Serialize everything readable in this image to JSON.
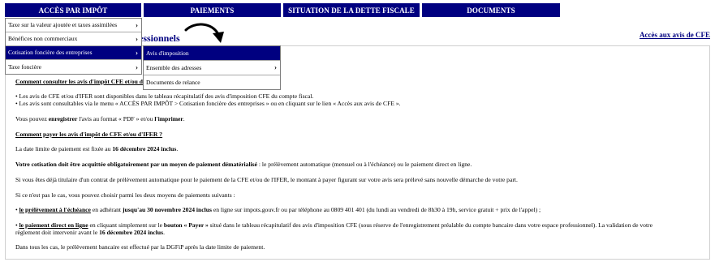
{
  "nav": {
    "tabs": [
      "ACCÈS PAR IMPÔT",
      "PAIEMENTS",
      "SITUATION DE LA DETTE FISCALE",
      "DOCUMENTS"
    ]
  },
  "menu": {
    "items": [
      "Taxe sur la valeur ajoutée et taxes assimilées",
      "Bénéfices non commerciaux",
      "Cotisation foncière des entreprises",
      "Taxe foncière"
    ],
    "chevron": "›"
  },
  "submenu": {
    "items": [
      "Avis d'imposition",
      "Ensemble des adresses",
      "Documents de relance"
    ]
  },
  "header": {
    "title_fragment": "essionnels",
    "link": "Accès aux avis de CFE"
  },
  "content": {
    "h1": "Comment consulter les avis d'impôt CFE et/ou d'",
    "p1a": "• Les avis de CFE et/ou d'IFER sont disponibles dans le tableau récapitulatif des avis d'imposition CFE du compte fiscal.",
    "p1b": "• Les avis sont consultables via le menu « ACCÈS PAR IMPÔT > Cotisation foncière des entreprises » ou en cliquant sur le lien « Accès aux avis de CFE ».",
    "p2_pre": "Vous pouvez ",
    "p2_b1": "enregistrer",
    "p2_mid": " l'avis au format « PDF » et/ou ",
    "p2_b2": "l'imprimer",
    "p2_end": ".",
    "h2": "Comment payer les avis d'impôt de CFE et/ou d'IFER ?",
    "p3_pre": "La date limite de paiement est fixée au ",
    "p3_b": "16 décembre 2024 inclus",
    "p3_end": ".",
    "p4_b": "Votre cotisation doit être acquittée obligatoirement par un moyen de paiement dématérialisé",
    "p4_end": " : le prélèvement automatique (mensuel ou à l'échéance) ou le paiement direct en ligne.",
    "p5": "Si vous êtes déjà titulaire d'un contrat de prélèvement automatique pour le paiement de la CFE et/ou de l'IFER, le montant à payer figurant sur votre avis sera prélevé sans nouvelle démarche de votre part.",
    "p6": "Si ce n'est pas le cas, vous pouvez choisir parmi les deux moyens de paiements suivants :",
    "p7_bullet": "• ",
    "p7_u": "le prélèvement à l'échéance",
    "p7_mid": " en adhérant ",
    "p7_b": "jusqu'au 30 novembre 2024 inclus",
    "p7_end": " en ligne sur impots.gouv.fr ou par téléphone au 0809 401 401 (du lundi au vendredi de 8h30 à 19h, service gratuit + prix de l'appel) ;",
    "p8_bullet": "• ",
    "p8_u": "le paiement direct en ligne",
    "p8_mid": " en cliquant simplement sur le ",
    "p8_b": "bouton « Payer »",
    "p8_end": " situé dans le tableau récapitulatif des avis d'imposition CFE (sous réserve de l'enregistrement préalable du compte bancaire dans votre espace professionnel). La validation de votre",
    "p8_line2_pre": "règlement doit intervenir avant le ",
    "p8_line2_b": "16 décembre 2024 inclus",
    "p8_line2_end": ".",
    "p9": "Dans tous les cas, le prélèvement bancaire est effectué par la DGFiP après la date limite de paiement."
  },
  "colors": {
    "navy": "#000080",
    "white": "#ffffff"
  }
}
